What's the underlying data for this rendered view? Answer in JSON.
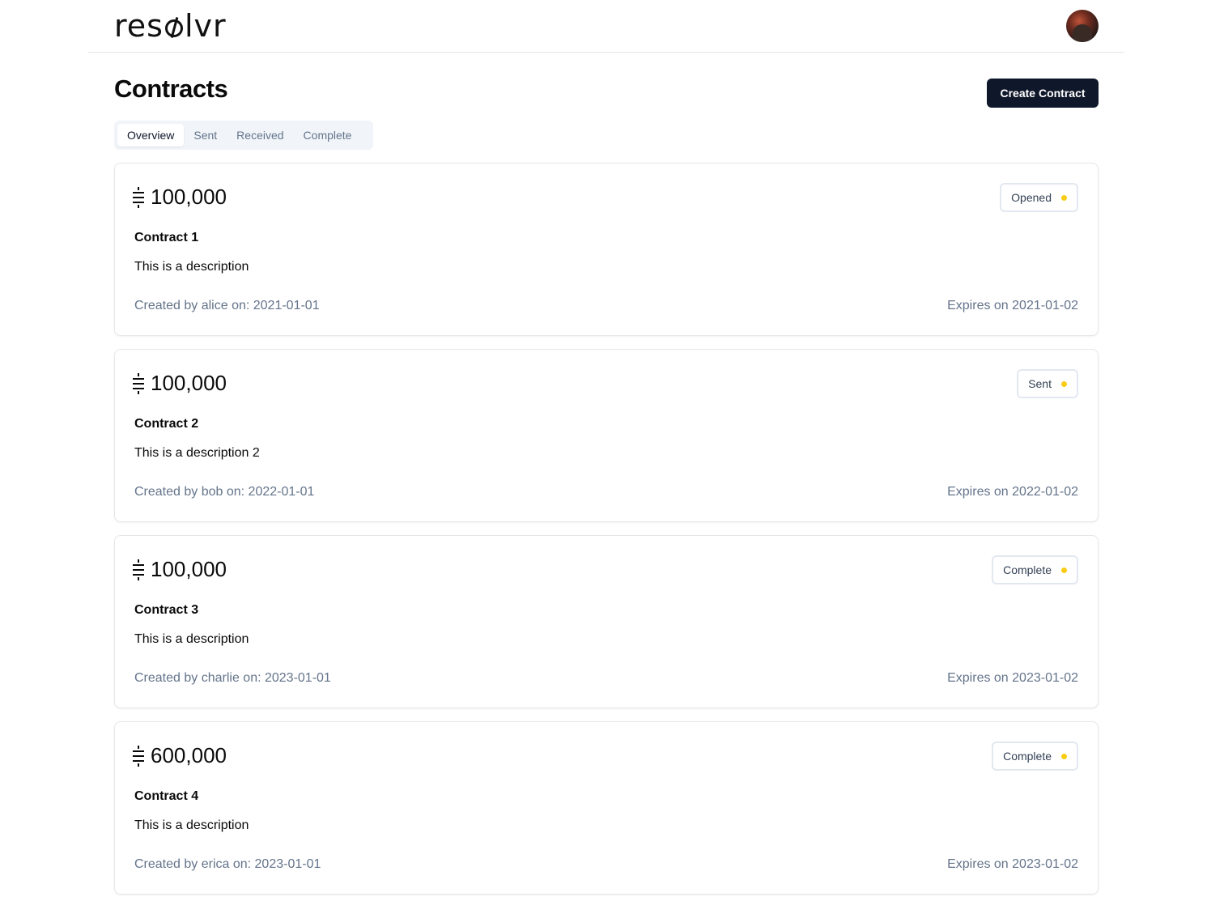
{
  "app": {
    "logo_text_left": "res",
    "logo_text_right": "lvr"
  },
  "header": {
    "title": "Contracts",
    "create_button_label": "Create Contract"
  },
  "tabs": [
    {
      "label": "Overview",
      "active": true
    },
    {
      "label": "Sent",
      "active": false
    },
    {
      "label": "Received",
      "active": false
    },
    {
      "label": "Complete",
      "active": false
    }
  ],
  "contracts": [
    {
      "amount": "100,000",
      "status": "Opened",
      "name": "Contract 1",
      "description": "This is a description",
      "created": "Created by alice on: 2021-01-01",
      "expires": "Expires on 2021-01-02"
    },
    {
      "amount": "100,000",
      "status": "Sent",
      "name": "Contract 2",
      "description": "This is a description 2",
      "created": "Created by bob on: 2022-01-01",
      "expires": "Expires on 2022-01-02"
    },
    {
      "amount": "100,000",
      "status": "Complete",
      "name": "Contract 3",
      "description": "This is a description",
      "created": "Created by charlie on: 2023-01-01",
      "expires": "Expires on 2023-01-02"
    },
    {
      "amount": "600,000",
      "status": "Complete",
      "name": "Contract 4",
      "description": "This is a description",
      "created": "Created by erica on: 2023-01-01",
      "expires": "Expires on 2023-01-02"
    }
  ],
  "colors": {
    "primary_button": "#0f172a",
    "status_dot": "#facc15",
    "muted_text": "#64748b",
    "border": "#e5e7eb"
  },
  "icons": {
    "currency": "sats-currency-icon",
    "status_dot": "status-dot-icon",
    "avatar": "user-avatar"
  }
}
